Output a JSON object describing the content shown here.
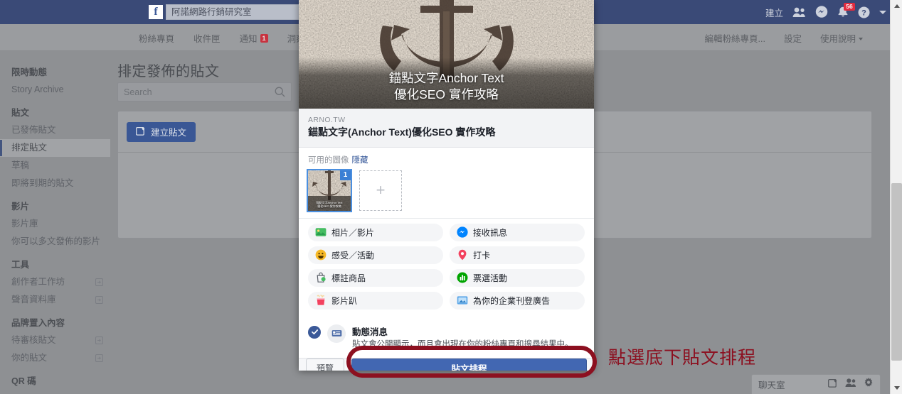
{
  "topbar": {
    "logo_letter": "f",
    "search_value": "阿諾網路行銷研究室",
    "create_label": "建立",
    "icons": [
      "friend-requests-icon",
      "messenger-icon",
      "notifications-icon",
      "help-icon",
      "account-menu-caret"
    ],
    "notification_count": "56"
  },
  "subnav": {
    "tabs": [
      "粉絲專頁",
      "收件匣",
      "通知",
      "洞察報告"
    ],
    "notification_badge": "1",
    "right_tabs": [
      "編輯粉絲專頁...",
      "設定",
      "使用說明"
    ]
  },
  "sidebar": {
    "groups": [
      {
        "title": "限時動態",
        "items": [
          {
            "label": "Story Archive",
            "active": false,
            "external": false
          }
        ]
      },
      {
        "title": "貼文",
        "items": [
          {
            "label": "已發佈貼文",
            "active": false,
            "external": false
          },
          {
            "label": "排定貼文",
            "active": true,
            "external": false
          },
          {
            "label": "草稿",
            "active": false,
            "external": false
          },
          {
            "label": "即將到期的貼文",
            "active": false,
            "external": false
          }
        ]
      },
      {
        "title": "影片",
        "items": [
          {
            "label": "影片庫",
            "active": false,
            "external": false
          },
          {
            "label": "你可以多文發佈的影片",
            "active": false,
            "external": false
          }
        ]
      },
      {
        "title": "工具",
        "items": [
          {
            "label": "創作者工作坊",
            "active": false,
            "external": true
          },
          {
            "label": "聲音資料庫",
            "active": false,
            "external": true
          }
        ]
      },
      {
        "title": "品牌置入內容",
        "items": [
          {
            "label": "待審核貼文",
            "active": false,
            "external": true
          },
          {
            "label": "你的貼文",
            "active": false,
            "external": true
          }
        ]
      },
      {
        "title": "QR 碼",
        "items": []
      }
    ]
  },
  "main": {
    "page_title": "排定發佈的貼文",
    "search_placeholder": "Search",
    "create_post_label": "建立貼文"
  },
  "chatbar": {
    "label": "聊天室",
    "icons": [
      "compose-icon",
      "people-icon",
      "gear-icon"
    ]
  },
  "modal": {
    "hero": {
      "line1": "錨點文字Anchor Text",
      "line2": "優化SEO 實作攻略"
    },
    "link_preview": {
      "domain": "ARNO.TW",
      "title": "錨點文字(Anchor Text)優化SEO 實作攻略"
    },
    "images_section": {
      "label": "可用的圖像",
      "hide_label": "隱藏",
      "selected_badge": "1",
      "thumb_caption_line1": "錨點文字Anchor Text",
      "thumb_caption_line2": "優化SEO 實作攻略",
      "add_label": "+"
    },
    "options": [
      {
        "label": "相片／影片",
        "icon": "photo-video-icon"
      },
      {
        "label": "接收訊息",
        "icon": "messenger-icon"
      },
      {
        "label": "感受／活動",
        "icon": "feeling-activity-icon"
      },
      {
        "label": "打卡",
        "icon": "location-pin-icon"
      },
      {
        "label": "標註商品",
        "icon": "tag-product-icon"
      },
      {
        "label": "票選活動",
        "icon": "poll-icon"
      },
      {
        "label": "影片趴",
        "icon": "watch-party-icon"
      },
      {
        "label": "為你的企業刊登廣告",
        "icon": "advertise-icon"
      }
    ],
    "share_option": {
      "title": "動態消息",
      "description": "貼文會公開顯示，而且會出現在你的粉絲專頁和搜尋結果中。",
      "checked": true,
      "icon": "news-feed-icon"
    },
    "footer": {
      "preview_label": "預覽",
      "schedule_label": "貼文排程"
    }
  },
  "annotation": {
    "text": "點選底下貼文排程",
    "color": "#8c1020"
  }
}
